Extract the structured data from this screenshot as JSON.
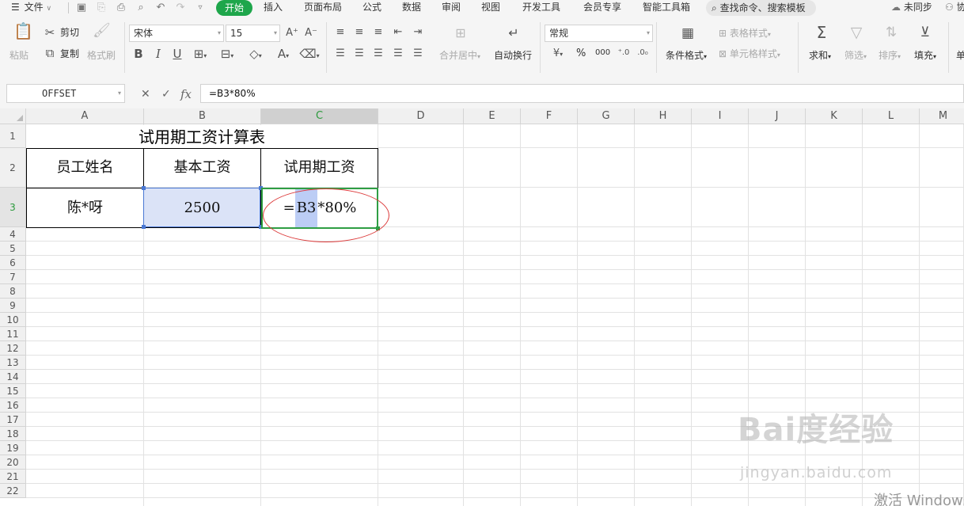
{
  "menubar": {
    "file": "文件",
    "tabs": [
      "开始",
      "插入",
      "页面布局",
      "公式",
      "数据",
      "审阅",
      "视图",
      "开发工具",
      "会员专享",
      "智能工具箱"
    ],
    "search": "查找命令、搜索模板",
    "sync": "未同步",
    "collab": "协"
  },
  "ribbon": {
    "paste": "粘贴",
    "cut": "剪切",
    "copy": "复制",
    "format_painter": "格式刷",
    "font_name": "宋体",
    "font_size": "15",
    "merge_center": "合并居中",
    "auto_wrap": "自动换行",
    "number_format": "常规",
    "percent_symbol": "%",
    "thousands_symbol": "000",
    "conditional_format": "条件格式",
    "table_style": "表格样式",
    "cell_style": "单元格样式",
    "sum": "求和",
    "filter": "筛选",
    "sort": "排序",
    "fill": "填充",
    "cut_partial": "单"
  },
  "formula_bar": {
    "name_box": "OFFSET",
    "fx": "fx",
    "formula": "=B3*80%"
  },
  "sheet": {
    "columns": [
      "A",
      "B",
      "C",
      "D",
      "E",
      "F",
      "G",
      "H",
      "I",
      "J",
      "K",
      "L",
      "M"
    ],
    "rows": [
      "1",
      "2",
      "3",
      "4",
      "5",
      "6",
      "7",
      "8",
      "9",
      "10",
      "11",
      "12",
      "13",
      "14",
      "15",
      "16",
      "17",
      "18",
      "19",
      "20",
      "21",
      "22"
    ],
    "selected_column": "C",
    "selected_row": "3",
    "title": "试用期工资计算表",
    "headers": [
      "员工姓名",
      "基本工资",
      "试用期工资"
    ],
    "row3": {
      "name": "陈*呀",
      "base_salary": "2500",
      "formula_eq": "=",
      "formula_ref": "B3",
      "formula_rest": "*80%"
    }
  },
  "overlay": {
    "watermark": "Bai度经验",
    "watermark_sub": "jingyan.baidu.com",
    "activate": "激活 Windows"
  },
  "colors": {
    "accent_green": "#1ea64b",
    "reference_blue": "#4a78d4",
    "annotation_red": "#dc3a3a"
  }
}
